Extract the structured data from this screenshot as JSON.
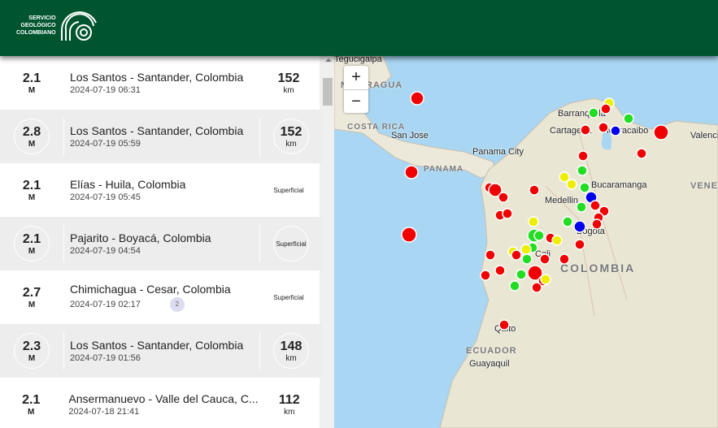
{
  "header": {
    "logo_text": [
      "SERVICIO",
      "GEOLÓGICO",
      "COLOMBIANO"
    ]
  },
  "events": [
    {
      "magnitude": "2.1",
      "mag_unit": "M",
      "place": "Los Santos - Santander, Colombia",
      "datetime": "2024-07-19 06:31",
      "depth": "152",
      "depth_unit": "km",
      "style": "white"
    },
    {
      "magnitude": "2.8",
      "mag_unit": "M",
      "place": "Los Santos - Santander, Colombia",
      "datetime": "2024-07-19 05:59",
      "depth": "152",
      "depth_unit": "km",
      "style": "gray"
    },
    {
      "magnitude": "2.1",
      "mag_unit": "M",
      "place": "Elías - Huila, Colombia",
      "datetime": "2024-07-19 05:45",
      "depth_label": "Superficial",
      "style": "white"
    },
    {
      "magnitude": "2.1",
      "mag_unit": "M",
      "place": "Pajarito - Boyacá, Colombia",
      "datetime": "2024-07-19 04:54",
      "depth_label": "Superficial",
      "style": "gray"
    },
    {
      "magnitude": "2.7",
      "mag_unit": "M",
      "place": "Chimichagua - Cesar, Colombia",
      "datetime": "2024-07-19 02:17",
      "badge": "2",
      "depth_label": "Superficial",
      "style": "white"
    },
    {
      "magnitude": "2.3",
      "mag_unit": "M",
      "place": "Los Santos - Santander, Colombia",
      "datetime": "2024-07-19 01:56",
      "depth": "148",
      "depth_unit": "km",
      "style": "gray"
    },
    {
      "magnitude": "2.1",
      "mag_unit": "M",
      "place": "Ansermanuevo - Valle del Cauca, C...",
      "datetime": "2024-07-18 21:41",
      "depth": "112",
      "depth_unit": "km",
      "style": "white"
    }
  ],
  "map": {
    "zoom_in": "+",
    "zoom_out": "−",
    "cities": [
      "Tegucigalpa",
      "San Jose",
      "Panama City",
      "Barranquilla",
      "Cartagena",
      "Maracaibo",
      "Valencia",
      "Bucaramanga",
      "Medellin",
      "Bogota",
      "Cali",
      "Quito",
      "Guayaquil"
    ],
    "countries": [
      "NICARAGUA",
      "COSTA RICA",
      "PANAMA",
      "COLOMBIA",
      "VENEZUELA",
      "ECUADOR"
    ],
    "marker_colors": {
      "red": "#f00000",
      "green": "#22dd22",
      "yellow": "#eeee00",
      "blue": "#0000ee"
    }
  }
}
